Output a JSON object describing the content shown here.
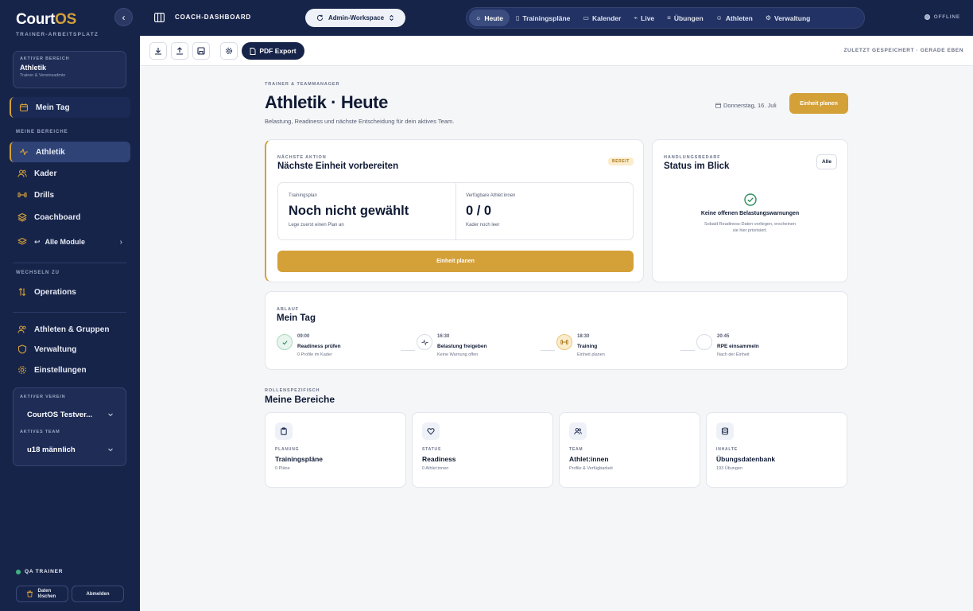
{
  "sidebar": {
    "logo_main": "Court",
    "logo_accent": "OS",
    "logo_sub": "TRAINER-ARBEITSPLATZ",
    "active_area_label": "AKTIVER BEREICH",
    "active_area_name": "Athletik",
    "active_area_role": "Trainer & Vereinsadmin",
    "my_day": "Mein Tag",
    "my_areas_label": "MEINE BEREICHE",
    "items": [
      "Athletik",
      "Kader",
      "Drills",
      "Coachboard",
      "Alle Module"
    ],
    "switch_label": "WECHSELN ZU",
    "operations": "Operations",
    "bottom_items": [
      "Athleten & Gruppen",
      "Verwaltung",
      "Einstellungen"
    ],
    "club_label": "AKTIVER VEREIN",
    "club_value": "CourtOS Testver...",
    "team_label": "AKTIVES TEAM",
    "team_value": "u18 männlich",
    "qa_user": "QA TRAINER",
    "delete_data": "Daten löschen",
    "logout": "Abmelden"
  },
  "topbar": {
    "title": "COACH-DASHBOARD",
    "workspace": "Admin-Workspace",
    "tabs": [
      "Heute",
      "Trainingspläne",
      "Kalender",
      "Live",
      "Übungen",
      "Athleten",
      "Verwaltung"
    ],
    "status": "OFFLINE"
  },
  "toolbar": {
    "pdf_export": "PDF Export",
    "saved": "ZULETZT GESPEICHERT · GERADE EBEN"
  },
  "header": {
    "overline": "TRAINER & TEAMMANAGER",
    "title": "Athletik · Heute",
    "description": "Belastung, Readiness und nächste Entscheidung für dein aktives Team.",
    "date": "Donnerstag, 16. Juli",
    "plan_button": "Einheit planen"
  },
  "next_action": {
    "overline": "NÄCHSTE AKTION",
    "title": "Nächste Einheit vorbereiten",
    "badge": "BEREIT",
    "plan_label": "Trainingsplan",
    "plan_value": "Noch nicht gewählt",
    "plan_hint": "Lege zuerst einen Plan an",
    "athletes_label": "Verfügbare Athlet:innen",
    "athletes_value": "0 / 0",
    "athletes_hint": "Kader noch leer",
    "button": "Einheit planen"
  },
  "status": {
    "overline": "HANDLUNGSBEDARF",
    "title": "Status im Blick",
    "filter": "Alle",
    "headline": "Keine offenen Belastungswarnungen",
    "text_line1": "Sobald Readiness-Daten vorliegen, erscheinen",
    "text_line2": "sie hier priorisiert."
  },
  "schedule": {
    "overline": "ABLAUF",
    "title": "Mein Tag",
    "steps": [
      {
        "time": "09:00",
        "name": "Readiness prüfen",
        "sub": "0 Profile im Kader"
      },
      {
        "time": "16:30",
        "name": "Belastung freigeben",
        "sub": "Keine Warnung offen"
      },
      {
        "time": "18:30",
        "name": "Training",
        "sub": "Einheit planen"
      },
      {
        "time": "20:45",
        "name": "RPE einsammeln",
        "sub": "Nach der Einheit"
      }
    ]
  },
  "areas": {
    "overline": "ROLLENSPEZIFISCH",
    "title": "Meine Bereiche",
    "cards": [
      {
        "cat": "PLANUNG",
        "name": "Trainingspläne",
        "sub": "0 Pläne"
      },
      {
        "cat": "STATUS",
        "name": "Readiness",
        "sub": "0 Athlet:innen"
      },
      {
        "cat": "TEAM",
        "name": "Athlet:innen",
        "sub": "Profile & Verfügbarkeit"
      },
      {
        "cat": "INHALTE",
        "name": "Übungsdatenbank",
        "sub": "193 Übungen"
      }
    ]
  },
  "colors": {
    "navy": "#17244a",
    "gold": "#d4a038",
    "background": "#f5f6f8",
    "success": "#3fb37f"
  }
}
